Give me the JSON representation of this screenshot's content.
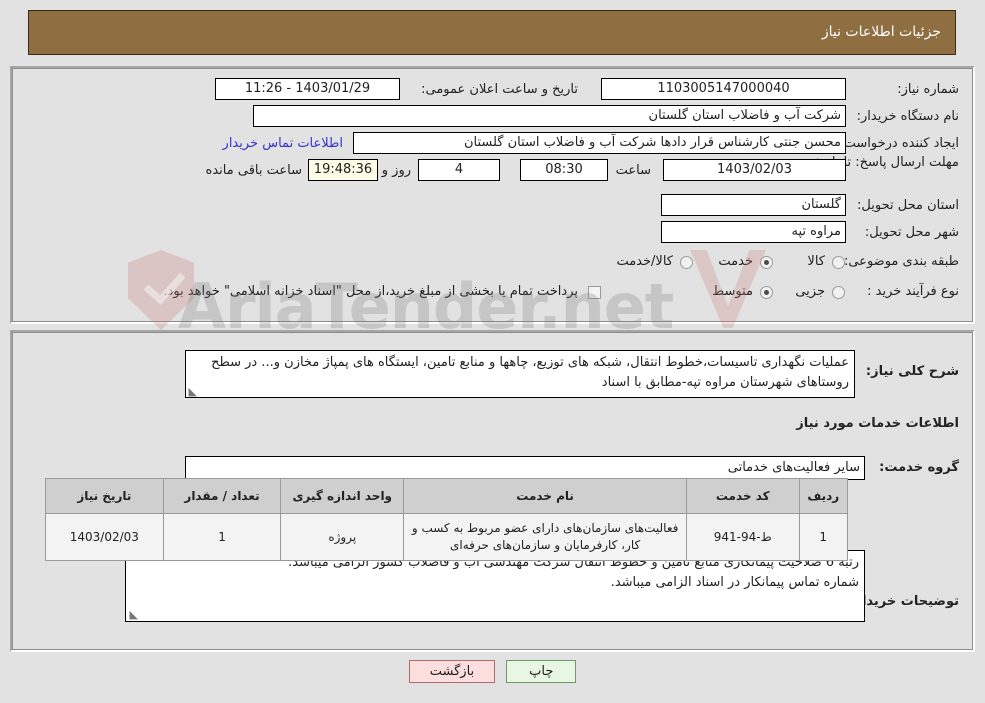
{
  "header": {
    "title": "جزئیات اطلاعات نیاز"
  },
  "form": {
    "need_number": {
      "label": "شماره نیاز:",
      "value": "1103005147000040"
    },
    "buyer_org": {
      "label": "نام دستگاه خریدار:",
      "value": "شرکت آب و فاضلاب استان گلستان"
    },
    "creator": {
      "label": "ایجاد کننده درخواست:",
      "value": "محسن جنتی کارشناس قرار دادها شرکت آب و فاضلاب استان گلستان"
    },
    "deadline": {
      "label": "مهلت ارسال پاسخ: تا تاریخ:",
      "date": "1403/02/03",
      "hour_label": "ساعت",
      "hour": "08:30",
      "days": "4",
      "days_label": "روز و",
      "countdown": "19:48:36",
      "countdown_label": "ساعت باقی مانده"
    },
    "public_announce": {
      "label": "تاریخ و ساعت اعلان عمومی:",
      "value": "1403/01/29 - 11:26"
    },
    "province": {
      "label": "استان محل تحویل:",
      "value": "گلستان"
    },
    "city": {
      "label": "شهر محل تحویل:",
      "value": "مراوه تپه"
    },
    "category": {
      "label": "طبقه بندی موضوعی:",
      "options": [
        {
          "label": "کالا",
          "selected": false
        },
        {
          "label": "خدمت",
          "selected": true
        },
        {
          "label": "کالا/خدمت",
          "selected": false
        }
      ]
    },
    "process_type": {
      "label": "نوع فرآیند خرید :",
      "options": [
        {
          "label": "جزیی",
          "selected": false
        },
        {
          "label": "متوسط",
          "selected": true
        }
      ],
      "checkbox_note": "پرداخت تمام یا بخشی از مبلغ خرید،از محل \"اسناد خزانه اسلامی\" خواهد بود.",
      "checkbox_checked": false
    },
    "buyer_contact_link": "اطلاعات تماس خریدار"
  },
  "description": {
    "label": "شرح کلی نیاز:",
    "value": "عملیات نگهداری تاسیسات،خطوط انتقال، شبکه های توزیع، چاهها و منابع تامین، ایستگاه های پمپاژ مخازن و... در سطح روستاهای شهرستان مراوه تپه-مطابق با اسناد"
  },
  "services_section": {
    "heading": "اطلاعات خدمات مورد نیاز",
    "group_label": "گروه خدمت:",
    "group_value": "سایر فعالیت‌های خدماتی"
  },
  "table": {
    "columns": [
      "ردیف",
      "کد خدمت",
      "نام خدمت",
      "واحد اندازه گیری",
      "تعداد / مقدار",
      "تاریخ نیاز"
    ],
    "rows": [
      {
        "row_no": "1",
        "service_code": "ط-94-941",
        "service_name": "فعالیت‌های سازمان‌های دارای عضو مربوط به کسب و کار، کارفرمایان و سازمان‌های حرفه‌ای",
        "unit": "پروژه",
        "quantity": "1",
        "need_date": "1403/02/03"
      }
    ]
  },
  "buyer_notes": {
    "label": "توضیحات خریدار:",
    "line1": "رتبه 6 صلاحیت پیمانکاری منابع تامین و خطوط انتقال شرکت مهندسی آب و فاضلاب کشور الزامی میباشد.",
    "line2": "شماره تماس پیمانکار در اسناد الزامی میباشد."
  },
  "footer": {
    "print_label": "چاپ",
    "back_label": "بازگشت"
  },
  "watermark": {
    "text": "AriaTender.net"
  },
  "colors": {
    "header_bg": "#8f6f42",
    "page_bg": "#e2e2e2",
    "link": "#3333cc",
    "table_header_bg": "#cfcfcf",
    "print_btn_bg": "#e8f7e3",
    "back_btn_bg": "#fcdede",
    "countdown_bg": "#fdfce6"
  }
}
